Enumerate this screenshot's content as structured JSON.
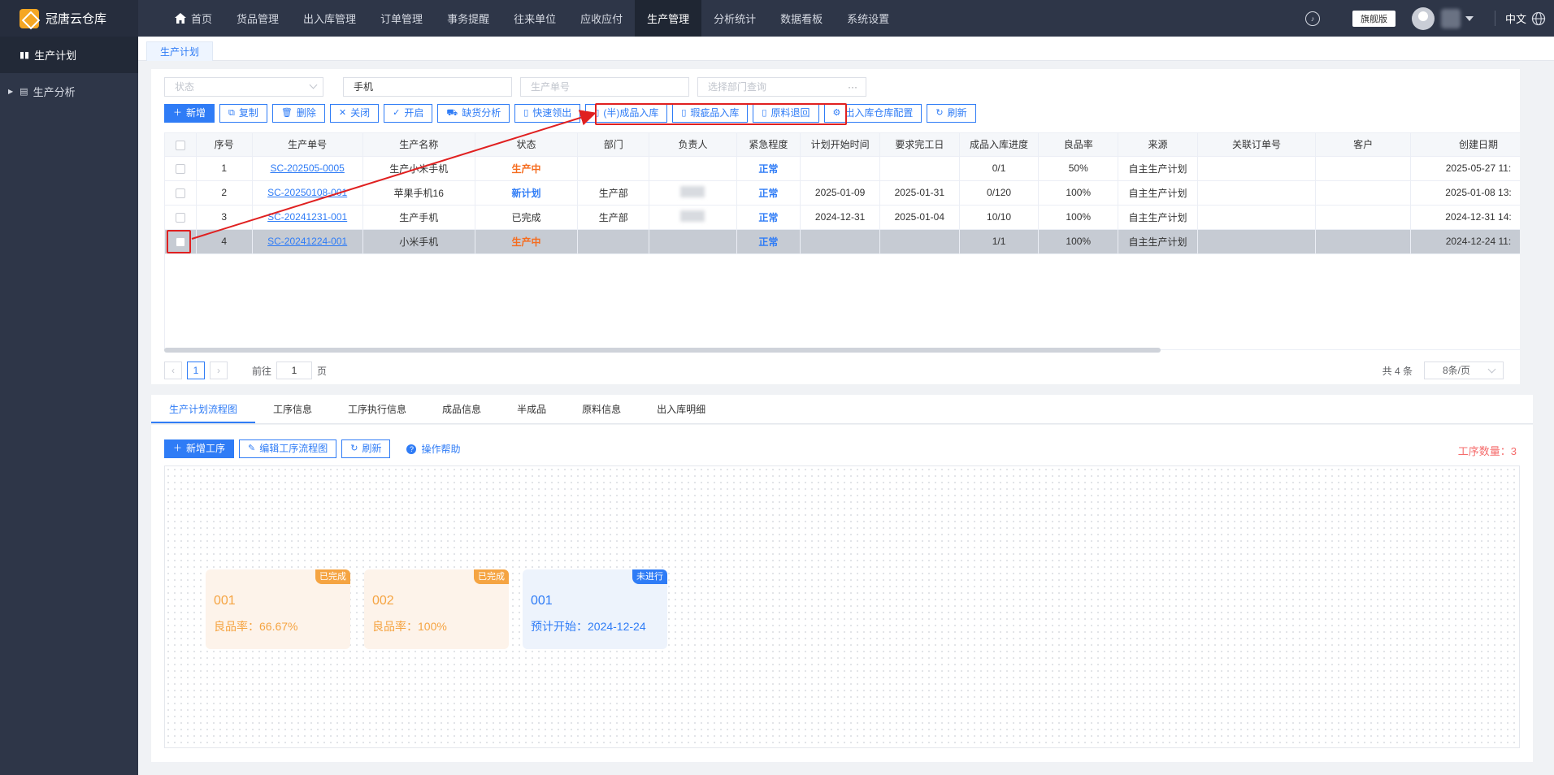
{
  "app": {
    "name": "冠唐云仓库"
  },
  "topnav": [
    "首页",
    "货品管理",
    "出入库管理",
    "订单管理",
    "事务提醒",
    "往来单位",
    "应收应付",
    "生产管理",
    "分析统计",
    "数据看板",
    "系统设置"
  ],
  "topright": {
    "edition": "旗舰版",
    "lang": "中文"
  },
  "sidebar": {
    "items": [
      {
        "label": "生产计划"
      },
      {
        "label": "生产分析"
      }
    ]
  },
  "tab": {
    "label": "生产计划"
  },
  "filters": {
    "status_placeholder": "状态",
    "name_value": "手机",
    "order_placeholder": "生产单号",
    "dept_placeholder": "选择部门查询"
  },
  "toolbar": {
    "add": "新增",
    "copy": "复制",
    "delete": "删除",
    "close": "关闭",
    "open": "开启",
    "shortage": "缺货分析",
    "quick_pick": "快速领出",
    "semi_in": "(半)成品入库",
    "defect_in": "瑕疵品入库",
    "material_return": "原料退回",
    "wh_config": "出入库仓库配置",
    "refresh": "刷新"
  },
  "table": {
    "headers": [
      "序号",
      "生产单号",
      "生产名称",
      "状态",
      "部门",
      "负责人",
      "紧急程度",
      "计划开始时间",
      "要求完工日",
      "成品入库进度",
      "良品率",
      "来源",
      "关联订单号",
      "客户",
      "创建日期"
    ],
    "rows": [
      {
        "no": "1",
        "order": "SC-202505-0005",
        "name": "生产小米手机",
        "status": "生产中",
        "status_type": "orange",
        "dept": "",
        "urgency": "正常",
        "start": "",
        "due": "",
        "progress": "0/1",
        "yield": "50%",
        "source": "自主生产计划",
        "related": "",
        "customer": "",
        "created": "2025-05-27 11:"
      },
      {
        "no": "2",
        "order": "SC-20250108-001",
        "name": "苹果手机16",
        "status": "新计划",
        "status_type": "blue",
        "dept": "生产部",
        "urgency": "正常",
        "start": "2025-01-09",
        "due": "2025-01-31",
        "progress": "0/120",
        "yield": "100%",
        "source": "自主生产计划",
        "related": "",
        "customer": "",
        "created": "2025-01-08 13:"
      },
      {
        "no": "3",
        "order": "SC-20241231-001",
        "name": "生产手机",
        "status": "已完成",
        "status_type": "gray",
        "dept": "生产部",
        "urgency": "正常",
        "start": "2024-12-31",
        "due": "2025-01-04",
        "progress": "10/10",
        "yield": "100%",
        "source": "自主生产计划",
        "related": "",
        "customer": "",
        "created": "2024-12-31 14:"
      },
      {
        "no": "4",
        "order": "SC-20241224-001",
        "name": "小米手机",
        "status": "生产中",
        "status_type": "orange",
        "dept": "",
        "urgency": "正常",
        "start": "",
        "due": "",
        "progress": "1/1",
        "yield": "100%",
        "source": "自主生产计划",
        "related": "",
        "customer": "",
        "created": "2024-12-24 11:"
      }
    ]
  },
  "pager": {
    "current": "1",
    "goto_prefix": "前往",
    "goto_value": "1",
    "goto_suffix": "页",
    "total": "共 4 条",
    "size": "8条/页"
  },
  "lower_tabs": [
    "生产计划流程图",
    "工序信息",
    "工序执行信息",
    "成品信息",
    "半成品",
    "原料信息",
    "出入库明细"
  ],
  "flow": {
    "add": "新增工序",
    "edit": "编辑工序流程图",
    "refresh": "刷新",
    "help": "操作帮助",
    "count_label": "工序数量：3",
    "cards": [
      {
        "tag": "已完成",
        "code": "001",
        "desc": "良品率：66.67%",
        "state": "done"
      },
      {
        "tag": "已完成",
        "code": "002",
        "desc": "良品率：100%",
        "state": "done"
      },
      {
        "tag": "未进行",
        "code": "001",
        "desc": "预计开始：2024-12-24",
        "state": "todo"
      }
    ]
  },
  "colors": {
    "primary": "#2f7cf6",
    "header_bg": "#2e3648",
    "highlight": "#e02020",
    "orange": "#f56c1f"
  }
}
